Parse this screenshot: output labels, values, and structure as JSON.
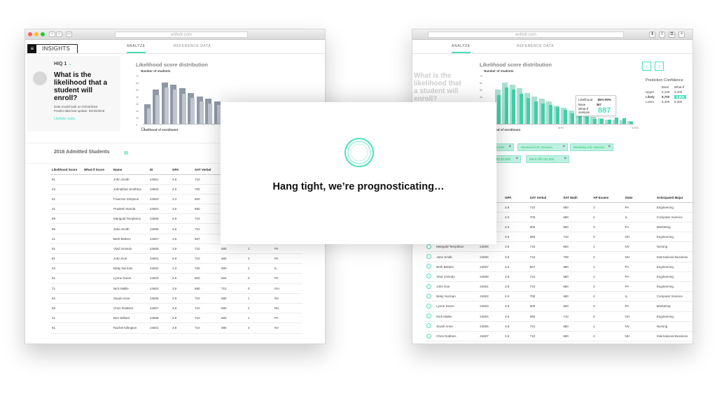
{
  "app": {
    "brand": "INSIGHTS",
    "menu_icon": "hamburger-icon",
    "tabs": [
      "ANALYZE",
      "REFERENCE DATA"
    ],
    "url": "enhotr.com",
    "accent": "#4ce0bd"
  },
  "question": {
    "id": "HIQ 1",
    "title": "What is the likelihood that a student will enroll?",
    "built": "Data model built on 02/15/2016",
    "predict": "Predict data last update: 02/15/2016",
    "update_link": "Update data"
  },
  "chart": {
    "title": "Likelihood score distribution",
    "ylabel": "Number of students",
    "xlabel": "Likelihood of enrollment",
    "xticks": [
      "0%",
      "50%",
      "100%"
    ]
  },
  "chart_data": {
    "type": "bar",
    "title": "Likelihood score distribution",
    "xlabel": "Likelihood of enrollment",
    "ylabel": "Number of students",
    "yticks": [
      "7k",
      "6k",
      "5k",
      "4k",
      "3k",
      "2k",
      "1k",
      "0"
    ],
    "ylim": [
      0,
      7000
    ],
    "xticks": [
      "0%",
      "50%",
      "100%"
    ],
    "series": [
      {
        "values": [
          2800,
          4900,
          5900,
          5600,
          5100,
          4400,
          3900,
          3600,
          3200,
          2600,
          2300,
          1900,
          1700,
          1400,
          1000,
          800,
          600,
          600,
          500,
          400
        ]
      },
      {
        "values": [
          2200,
          4100,
          5200,
          4900,
          4300,
          3700,
          3200,
          2900,
          2700,
          2400,
          2000,
          1500,
          1300,
          1000,
          700,
          700,
          600,
          900,
          800,
          300
        ]
      }
    ]
  },
  "right_chart": {
    "yticks": [
      "7k",
      "6k",
      "5k",
      "4k",
      "3k",
      "2k",
      "1k"
    ],
    "tooltip": {
      "likelihood_label": "Likelihood",
      "likelihood_value": "85%-90%",
      "base_label": "Base",
      "base_value": "367",
      "whatif_label": "What-if analysis",
      "whatif_value": "887"
    }
  },
  "confidence": {
    "title": "Prediction Confidence",
    "col_base": "Base",
    "col_whatif": "What-if",
    "rows": [
      {
        "label": "Upper",
        "base": "8,100",
        "whatif": "9,200"
      },
      {
        "label": "Likely",
        "base": "8,750",
        "whatif": "9,800"
      },
      {
        "label": "Lower",
        "base": "8,400",
        "whatif": "8,350"
      }
    ]
  },
  "filters": [
    "Campus Visit",
    "Weekend Info Session",
    "Weekday Info Session",
    "Merit offer $1,000",
    "Merit offer $2,500"
  ],
  "section": {
    "title": "2016 Admitted Students"
  },
  "table": {
    "headers": [
      "Likelihood Score",
      "What-if Score",
      "Name",
      "ID",
      "GPA",
      "SAT Verbal",
      "SAT Math",
      "AP Exams",
      "State",
      "Anticipated Major"
    ],
    "rows": [
      [
        "81",
        "",
        "John Smith",
        "24601",
        "3.8",
        "710",
        "680",
        "2",
        "PA",
        "Engineering"
      ],
      [
        "43",
        "",
        "Johnathan Smithton",
        "24602",
        "4.0",
        "700",
        "680",
        "2",
        "IL",
        "Computer Science"
      ],
      [
        "51",
        "",
        "Francine Simpson",
        "24603",
        "3.3",
        "600",
        "650",
        "0",
        "PA",
        "Marketing"
      ],
      [
        "31",
        "",
        "Pradesh Narola",
        "24604",
        "3.6",
        "680",
        "710",
        "0",
        "OH",
        "Engineering"
      ],
      [
        "68",
        "",
        "Marigold Templeton",
        "24605",
        "3.9",
        "710",
        "660",
        "1",
        "NV",
        "Nursing"
      ],
      [
        "95",
        "",
        "Jane Smith",
        "24606",
        "3.6",
        "710",
        "709",
        "2",
        "NH",
        "International Business"
      ],
      [
        "41",
        "",
        "Beth Betters",
        "24607",
        "3.6",
        "567",
        "680",
        "1",
        "PA",
        "Engineering"
      ],
      [
        "91",
        "",
        "Vlad Vinimdo",
        "24608",
        "3.9",
        "710",
        "680",
        "1",
        "PA",
        "Engineering"
      ],
      [
        "81",
        "",
        "John Doe",
        "24601",
        "3.9",
        "710",
        "680",
        "2",
        "PA",
        "Engineering"
      ],
      [
        "43",
        "",
        "Betty Norman",
        "24602",
        "4.0",
        "700",
        "680",
        "2",
        "IL",
        "Computer Science"
      ],
      [
        "51",
        "",
        "Lynne Doers",
        "24603",
        "3.5",
        "600",
        "650",
        "0",
        "PA",
        "Marketing"
      ],
      [
        "71",
        "",
        "Nick Mallie",
        "24604",
        "3.6",
        "680",
        "710",
        "0",
        "OH",
        "Engineering"
      ],
      [
        "64",
        "",
        "Sarah Anne",
        "24605",
        "3.8",
        "710",
        "680",
        "1",
        "NV",
        "Nursing"
      ],
      [
        "55",
        "",
        "Chris Robbins",
        "24607",
        "3.6",
        "710",
        "680",
        "2",
        "NH",
        "International Business"
      ],
      [
        "41",
        "",
        "Ben Willard",
        "24608",
        "3.9",
        "710",
        "680",
        "1",
        "PA",
        "Engineering"
      ],
      [
        "81",
        "",
        "Rachel Killington",
        "24601",
        "3.8",
        "710",
        "680",
        "2",
        "NV",
        "Nursing"
      ]
    ]
  },
  "loading": {
    "message": "Hang tight, we’re prognosticating…"
  }
}
